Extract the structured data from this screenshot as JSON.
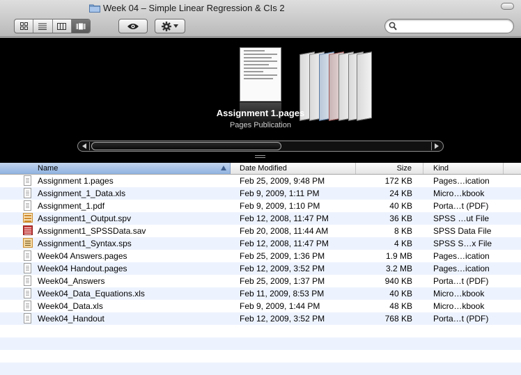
{
  "window": {
    "title": "Week 04 – Simple Linear Regression & CIs 2",
    "folder_icon": "folder-icon"
  },
  "toolbar": {
    "view_modes": [
      "icon-view",
      "list-view",
      "column-view",
      "coverflow-view"
    ],
    "active_view": "coverflow-view",
    "quicklook_icon": "eye-icon",
    "action_icon": "gear-icon",
    "search": {
      "value": "",
      "placeholder": ""
    }
  },
  "coverflow": {
    "selected_title": "Assignment 1.pages",
    "selected_kind": "Pages Publication"
  },
  "columns": {
    "name": "Name",
    "date": "Date Modified",
    "size": "Size",
    "kind": "Kind",
    "sort_column": "Name",
    "sort_direction": "ascending"
  },
  "files": [
    {
      "name": "Assignment 1.pages",
      "date": "Feb 25, 2009, 9:48 PM",
      "size": "172 KB",
      "kind": "Pages…ication",
      "icon": "pages-doc-icon"
    },
    {
      "name": "Assignment_1_Data.xls",
      "date": "Feb 9, 2009, 1:11 PM",
      "size": "24 KB",
      "kind": "Micro…kbook",
      "icon": "xls-doc-icon"
    },
    {
      "name": "Assignment_1.pdf",
      "date": "Feb 9, 2009, 1:10 PM",
      "size": "40 KB",
      "kind": "Porta…t (PDF)",
      "icon": "pdf-doc-icon"
    },
    {
      "name": "Assignment1_Output.spv",
      "date": "Feb 12, 2008, 11:47 PM",
      "size": "36 KB",
      "kind": "SPSS …ut File",
      "icon": "spss-output-icon"
    },
    {
      "name": "Assignment1_SPSSData.sav",
      "date": "Feb 20, 2008, 11:44 AM",
      "size": "8 KB",
      "kind": "SPSS Data File",
      "icon": "spss-data-icon"
    },
    {
      "name": "Assignment1_Syntax.sps",
      "date": "Feb 12, 2008, 11:47 PM",
      "size": "4 KB",
      "kind": "SPSS S…x File",
      "icon": "spss-syntax-icon"
    },
    {
      "name": "Week04 Answers.pages",
      "date": "Feb 25, 2009, 1:36 PM",
      "size": "1.9 MB",
      "kind": "Pages…ication",
      "icon": "pages-doc-icon"
    },
    {
      "name": "Week04 Handout.pages",
      "date": "Feb 12, 2009, 3:52 PM",
      "size": "3.2 MB",
      "kind": "Pages…ication",
      "icon": "pages-doc-icon"
    },
    {
      "name": "Week04_Answers",
      "date": "Feb 25, 2009, 1:37 PM",
      "size": "940 KB",
      "kind": "Porta…t (PDF)",
      "icon": "pdf-doc-icon"
    },
    {
      "name": "Week04_Data_Equations.xls",
      "date": "Feb 11, 2009, 8:53 PM",
      "size": "40 KB",
      "kind": "Micro…kbook",
      "icon": "xls-doc-icon"
    },
    {
      "name": "Week04_Data.xls",
      "date": "Feb 9, 2009, 1:44 PM",
      "size": "48 KB",
      "kind": "Micro…kbook",
      "icon": "xls-doc-icon"
    },
    {
      "name": "Week04_Handout",
      "date": "Feb 12, 2009, 3:52 PM",
      "size": "768 KB",
      "kind": "Porta…t (PDF)",
      "icon": "pdf-doc-icon"
    }
  ],
  "colors": {
    "header_selected": "#8fb2e0",
    "row_alt": "#edf3fe",
    "coverflow_bg": "#000000"
  }
}
